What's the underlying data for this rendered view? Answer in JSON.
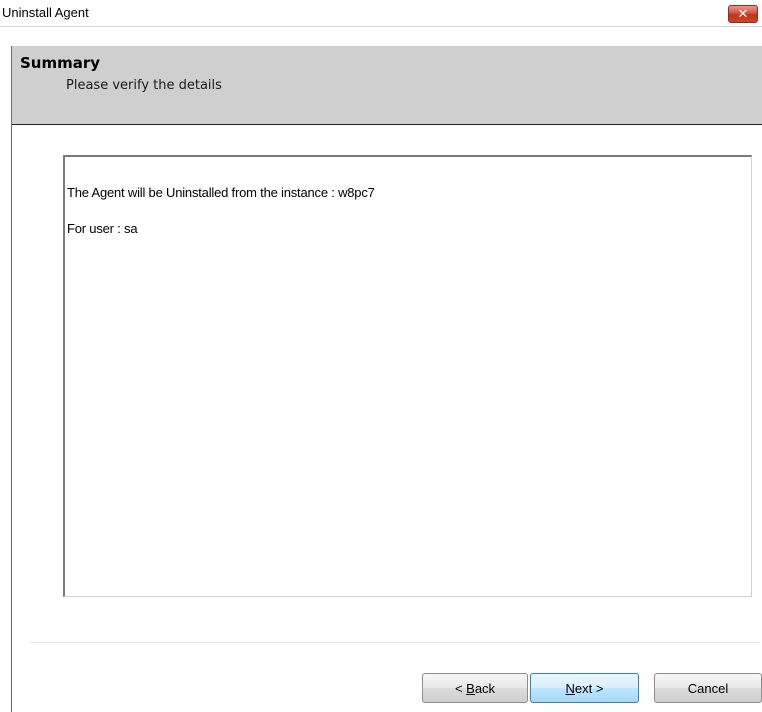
{
  "window": {
    "title": "Uninstall Agent",
    "close_glyph": "✕"
  },
  "header": {
    "title": "Summary",
    "subtitle": "Please verify the details"
  },
  "summary": {
    "lines": [
      "The Agent will be Uninstalled from the instance :  w8pc7",
      "For user : sa"
    ]
  },
  "buttons": {
    "back": {
      "prefix": "< ",
      "mnemonic": "B",
      "rest": "ack"
    },
    "next": {
      "prefix": "",
      "mnemonic": "N",
      "rest": "ext >"
    },
    "cancel": {
      "label": "Cancel"
    }
  },
  "colors": {
    "header_bg": "#cfcfcf",
    "close_button": "#c9452d",
    "default_button_border": "#3c7fb1"
  }
}
